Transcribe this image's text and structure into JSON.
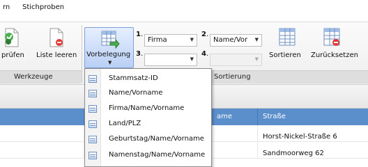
{
  "menu": {
    "tabs": [
      {
        "label": "rn"
      },
      {
        "label": "Stichproben"
      }
    ]
  },
  "ribbon": {
    "werkzeuge": {
      "label": "Werkzeuge",
      "pruefen_label": "prüfen",
      "liste_leeren_label": "Liste leeren"
    },
    "vorbelegung": {
      "label": "Vorbelegung"
    },
    "sortierung": {
      "label": "Sortierung",
      "slots": [
        {
          "number": "1",
          "value": ""
        },
        {
          "number": "2",
          "value": ""
        },
        {
          "number": "3",
          "value": ""
        },
        {
          "number": "4",
          "value": ""
        }
      ],
      "slot1_value": "Firma",
      "slot2_value": "Name/Vor",
      "slot3_value": "",
      "slot4_value": "",
      "sortieren_label": "Sortieren",
      "zuruecksetzen_label": "Zurücksetzen"
    }
  },
  "grid": {
    "columns": [
      {
        "label": "ame"
      },
      {
        "label": "Straße"
      }
    ],
    "rows": [
      {
        "strasse": "Horst-Nickel-Straße 6"
      },
      {
        "strasse": "Sandmoorweg 62"
      }
    ]
  },
  "dropdown": {
    "items": [
      {
        "label": "Stammsatz-ID"
      },
      {
        "label": "Name/Vorname"
      },
      {
        "label": "Firma/Name/Vorname"
      },
      {
        "label": "Land/PLZ"
      },
      {
        "label": "Geburtstag/Name/Vorname"
      },
      {
        "label": "Namenstag/Name/Vorname"
      }
    ]
  },
  "colors": {
    "header_blue": "#5b8fcb",
    "ribbon_bg": "#eeeeee",
    "accent_green": "#4caf50",
    "accent_red": "#e53935"
  },
  "icons": {
    "pruefen": "check-document-icon",
    "liste_leeren": "delete-document-icon",
    "vorbelegung": "grid-arrow-icon",
    "sortieren": "sort-grid-icon",
    "zuruecksetzen": "reset-grid-icon",
    "dropdown_item": "grid-list-icon"
  }
}
